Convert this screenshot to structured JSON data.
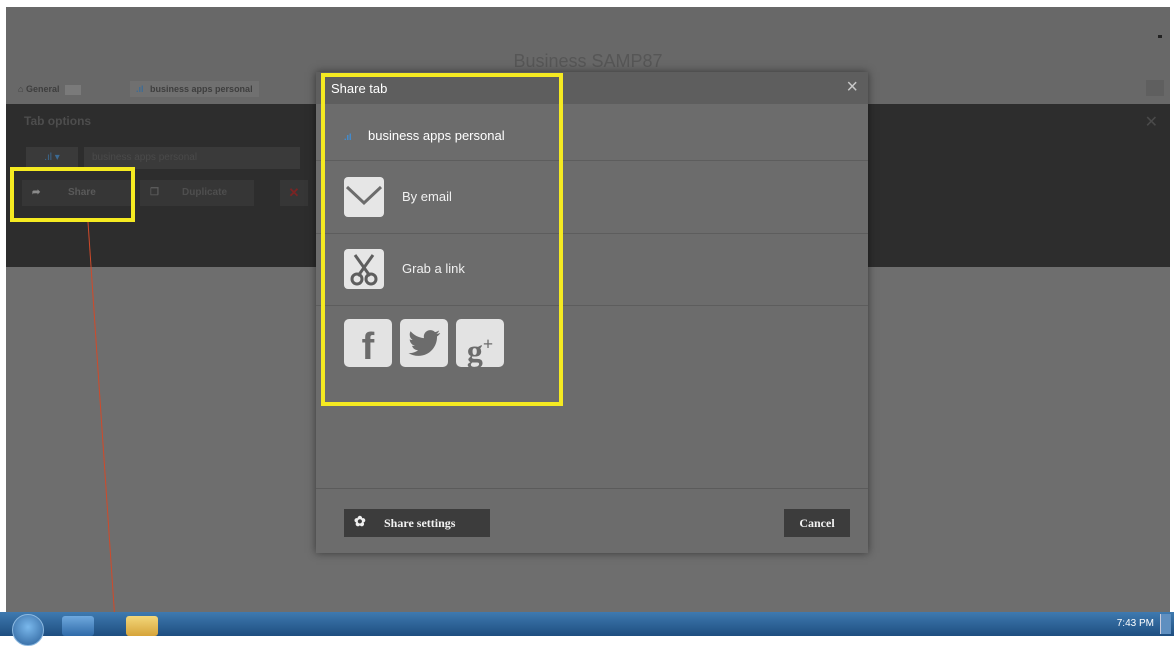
{
  "app": {
    "title": "Business SAMP87",
    "tabs": [
      {
        "label": "General"
      },
      {
        "label": "business apps personal",
        "icon": "bar-chart-icon"
      }
    ]
  },
  "tab_options": {
    "heading": "Tab options",
    "name_value": "business apps personal",
    "buttons": {
      "share": "Share",
      "duplicate": "Duplicate",
      "delete_icon": "close-icon"
    }
  },
  "dialog": {
    "title": "Share tab",
    "close_glyph": "×",
    "tab_name": "business apps personal",
    "options": {
      "email": {
        "label": "By email",
        "icon": "envelope-icon"
      },
      "link": {
        "label": "Grab a link",
        "icon": "scissors-icon"
      }
    },
    "social": {
      "facebook": "f",
      "google_plus": "g",
      "google_plus_sup": "+"
    },
    "footer": {
      "settings": "Share settings",
      "cancel": "Cancel"
    }
  },
  "annotation": {
    "highlight_color": "#f5ea21",
    "line_color": "#d04a2a"
  },
  "taskbar": {
    "time": "7:43 PM"
  }
}
